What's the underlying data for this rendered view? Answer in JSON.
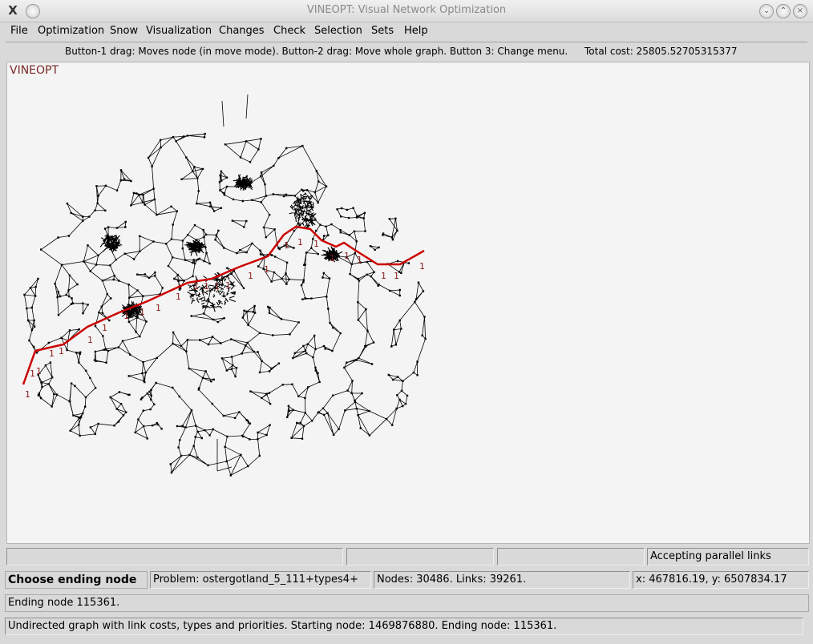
{
  "window": {
    "title": "VINEOPT: Visual Network Optimization",
    "app_icon_glyph": "X",
    "controls": [
      "minimize-icon",
      "maximize-icon",
      "close-icon"
    ]
  },
  "menu": {
    "file": "File",
    "optimization": "Optimization",
    "snow": "Snow",
    "visualization": "Visualization",
    "changes": "Changes",
    "check": "Check",
    "selection": "Selection",
    "sets": "Sets",
    "help": "Help"
  },
  "info": {
    "instructions": "Button-1 drag: Moves node (in move mode). Button-2 drag: Move whole graph. Button 3: Change menu.",
    "total_cost": "Total cost: 25805.52705315377"
  },
  "canvas": {
    "label": "VINEOPT",
    "network_color": "#000000",
    "route_color": "#cc0000",
    "route_label_text": "1"
  },
  "status": {
    "parallel": "Accepting parallel links",
    "mode": "Choose ending node",
    "problem": "Problem: ostergotland_5_111+types4+",
    "counts": "Nodes: 30486. Links: 39261.",
    "coords": "x: 467816.19, y: 6507834.17",
    "message": "Ending node 115361.",
    "description": "Undirected graph with link costs, types and priorities. Starting node: 1469876880. Ending node: 115361."
  }
}
